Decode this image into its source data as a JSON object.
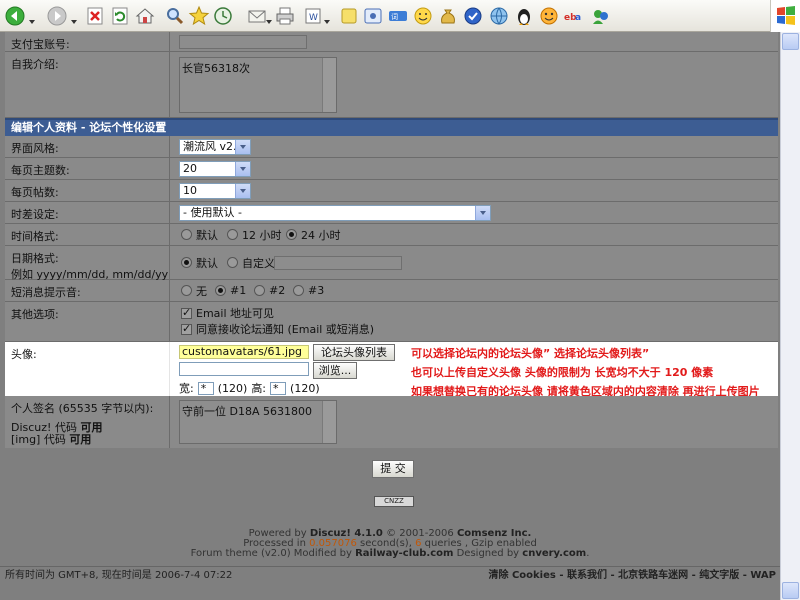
{
  "toolbar": {
    "icons": [
      "back-icon",
      "forward-icon",
      "stop-icon",
      "refresh-icon",
      "home-icon",
      "search-icon",
      "favorites-icon",
      "history-icon",
      "mail-icon",
      "print-icon",
      "edit-icon",
      "note-icon",
      "messenger-icon",
      "translate-icon",
      "smiley-icon",
      "money-bag-icon",
      "shield-icon",
      "globe-icon",
      "qq-penguin-icon",
      "emoticon-icon",
      "ebay-icon",
      "msn-icon"
    ]
  },
  "fields": {
    "alipay_label": "支付宝账号:",
    "intro_label": "自我介绍:",
    "intro_value": "长官56318次"
  },
  "section": {
    "title": "编辑个人资料 - 论坛个性化设置"
  },
  "settings": {
    "style_label": "界面风格:",
    "style_value": "潮流风 v2.0",
    "topics_label": "每页主题数:",
    "topics_value": "20",
    "posts_label": "每页帖数:",
    "posts_value": "10",
    "tz_label": "时差设定:",
    "tz_value": "- 使用默认 -",
    "timefmt_label": "时间格式:",
    "timefmt_opt1": "默认",
    "timefmt_opt2": "12 小时",
    "timefmt_opt3": "24 小时",
    "datefmt_label": "日期格式:",
    "datefmt_hint": "例如 yyyy/mm/dd, mm/dd/yy",
    "datefmt_opt1": "默认",
    "datefmt_opt2": "自定义:",
    "sound_label": "短消息提示音:",
    "sound_opt0": "无",
    "sound_opt1": "#1",
    "sound_opt2": "#2",
    "sound_opt3": "#3",
    "other_label": "其他选项:",
    "other_opt1": "Email 地址可见",
    "other_opt2": "同意接收论坛通知 (Email 或短消息)"
  },
  "avatar": {
    "label": "头像:",
    "path_value": "customavatars/61.jpg",
    "list_button": "论坛头像列表",
    "browse_button": "浏览...",
    "width_label": "宽:",
    "width_value": "*",
    "width_hint": "(120)",
    "height_label": "高:",
    "height_value": "*",
    "height_hint": "(120)",
    "note1": "可以选择论坛内的论坛头像” 选择论坛头像列表”",
    "note2": "也可以上传自定义头像  头像的限制为  长宽均不大于 120 像素",
    "note3": "如果想替换已有的论坛头像  请将黄色区域内的内容清除  再进行上传图片"
  },
  "signature": {
    "label": "个人签名 (65535 字节以内):",
    "discuz_code": "Discuz! 代码",
    "img_code": "[img] 代码",
    "enabled": "可用",
    "value": "守前一位  D18A 5631800"
  },
  "submit": {
    "label": "提  交"
  },
  "footer": {
    "stats_badge": "CNZZ",
    "powered_by": "Powered by",
    "product": "Discuz! 4.1.0",
    "copyright": "© 2001-2006",
    "company": "Comsenz Inc.",
    "processed_in": "Processed in",
    "time": "0.057076",
    "seconds": "second(s),",
    "queries_count": "6",
    "queries": "queries , Gzip enabled",
    "theme_line": "Forum theme (v2.0) Modified by",
    "mod_site": "Railway-club.com",
    "designed_by": "Designed by",
    "design_site": "cnvery.com",
    "period": "."
  },
  "statusbar": {
    "time_text": "所有时间为  GMT+8, 现在时间是  2006-7-4 07:22",
    "links": [
      "清除 Cookies",
      "联系我们",
      "北京铁路车迷网",
      "纯文字版",
      "WAP"
    ],
    "separator": " - "
  },
  "colors": {
    "section_header": "#3d5d93",
    "note_red": "#e21a1a",
    "background_dim": "#8a8a8a",
    "highlight": "#ffffff",
    "avatar_field": "#ffff99"
  }
}
